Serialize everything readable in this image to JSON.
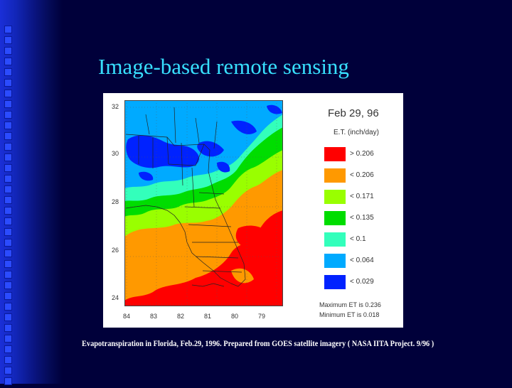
{
  "slide": {
    "title": "Image-based remote sensing",
    "caption": "Evapotranspiration in Florida, Feb.29, 1996. Prepared from GOES satellite imagery ( NASA IITA Project. 9/96 )"
  },
  "figure": {
    "date_label": "Feb 29, 96",
    "units_label": "E.T. (inch/day)",
    "y_ticks": [
      "32",
      "30",
      "28",
      "26",
      "24"
    ],
    "x_ticks": [
      "84",
      "83",
      "82",
      "81",
      "80",
      "79"
    ],
    "legend": [
      {
        "label": "> 0.206",
        "color": "#ff0000"
      },
      {
        "label": "< 0.206",
        "color": "#ff9900"
      },
      {
        "label": "< 0.171",
        "color": "#99ff00"
      },
      {
        "label": "< 0.135",
        "color": "#00dd00"
      },
      {
        "label": "< 0.1",
        "color": "#33ffbb"
      },
      {
        "label": "< 0.064",
        "color": "#00aaff"
      },
      {
        "label": "< 0.029",
        "color": "#0022ff"
      }
    ],
    "max_note": "Maximum ET is 0.236",
    "min_note": "Minimum ET is 0.018"
  },
  "colors": {
    "background": "#00003a",
    "title": "#38e0ff",
    "caption": "#ffffff"
  }
}
